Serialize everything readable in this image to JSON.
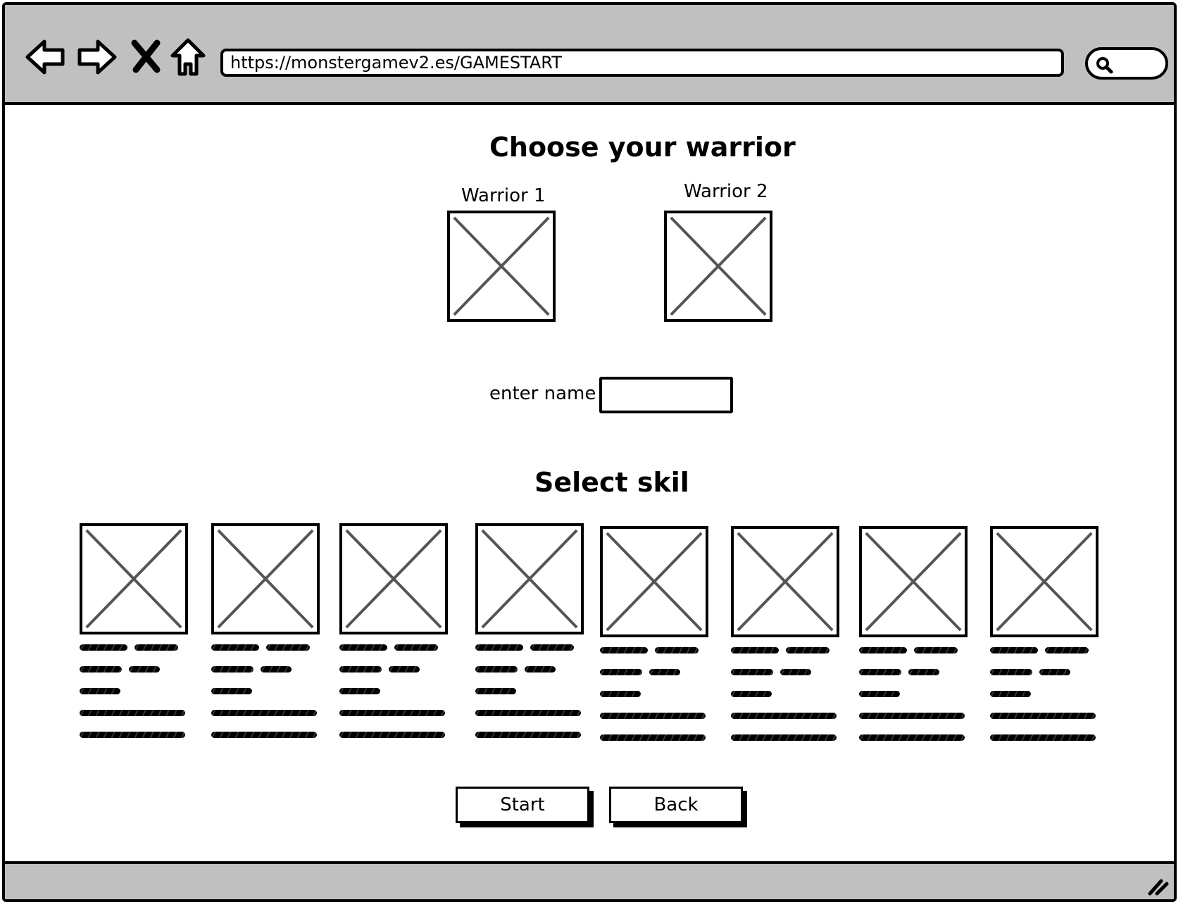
{
  "browser": {
    "url": "https://monstergamev2.es/GAMESTART",
    "nav_icons": [
      "back-arrow-icon",
      "forward-arrow-icon",
      "close-icon",
      "home-icon"
    ],
    "search_icon": "search-icon"
  },
  "main": {
    "title": "Choose your warrior",
    "warriors": [
      {
        "label": "Warrior 1"
      },
      {
        "label": "Warrior 2"
      }
    ],
    "name_label": "enter name",
    "name_value": "",
    "skills_title": "Select skil",
    "skills_count": 8
  },
  "buttons": {
    "start": "Start",
    "back": "Back"
  }
}
